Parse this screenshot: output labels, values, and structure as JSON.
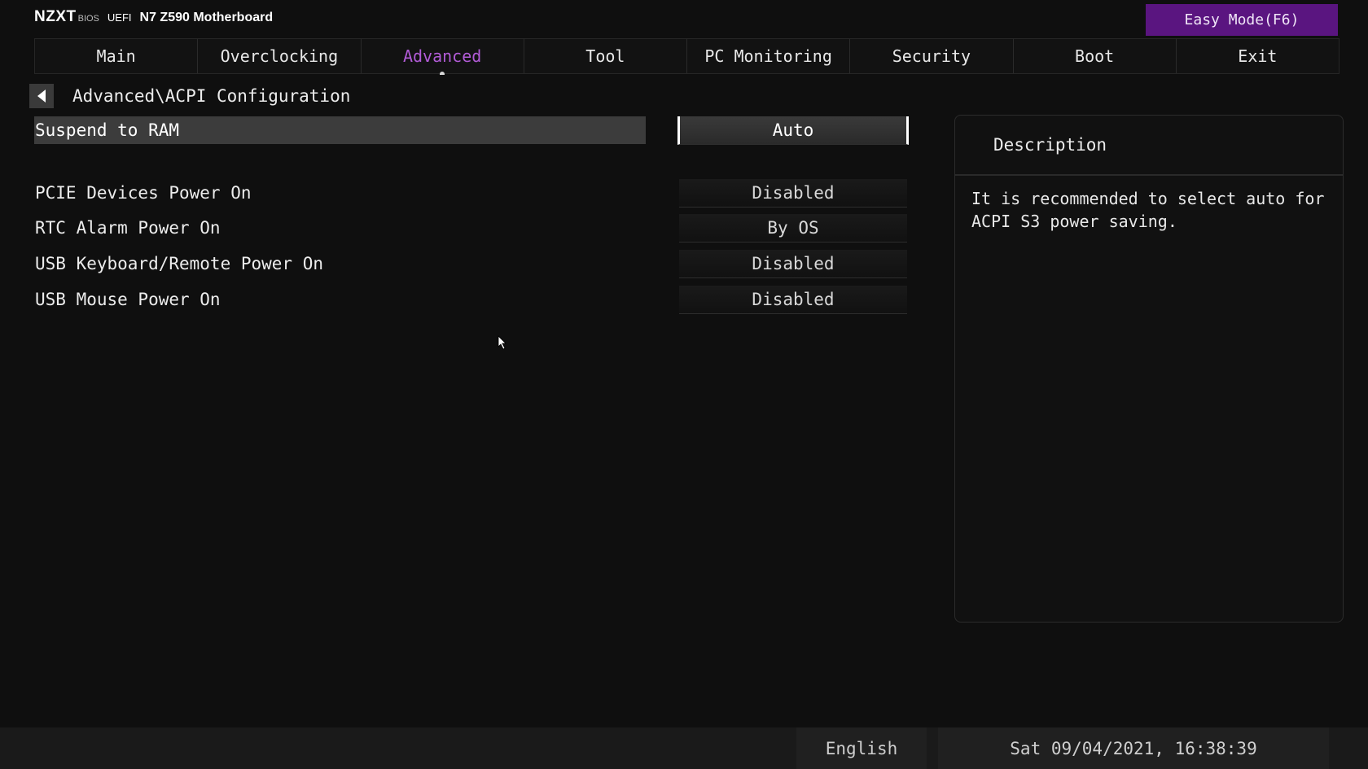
{
  "header": {
    "logo": "NZXT",
    "bios": "BIOS",
    "uefi": "UEFI",
    "model": "N7 Z590 Motherboard",
    "easy_mode_label": "Easy Mode(F6)"
  },
  "tabs": [
    {
      "label": "Main",
      "active": false
    },
    {
      "label": "Overclocking",
      "active": false
    },
    {
      "label": "Advanced",
      "active": true
    },
    {
      "label": "Tool",
      "active": false
    },
    {
      "label": "PC Monitoring",
      "active": false
    },
    {
      "label": "Security",
      "active": false
    },
    {
      "label": "Boot",
      "active": false
    },
    {
      "label": "Exit",
      "active": false
    }
  ],
  "breadcrumb": "Advanced\\ACPI Configuration",
  "settings": [
    {
      "label": "Suspend to RAM",
      "value": "Auto",
      "selected": true
    },
    {
      "label": "PCIE Devices Power On",
      "value": "Disabled",
      "selected": false
    },
    {
      "label": "RTC Alarm Power On",
      "value": "By OS",
      "selected": false
    },
    {
      "label": "USB Keyboard/Remote Power On",
      "value": "Disabled",
      "selected": false
    },
    {
      "label": "USB Mouse Power On",
      "value": "Disabled",
      "selected": false
    }
  ],
  "description": {
    "title": "Description",
    "text": "It is recommended to select auto for ACPI S3 power saving."
  },
  "footer": {
    "language": "English",
    "datetime": "Sat 09/04/2021, 16:38:39"
  },
  "colors": {
    "accent": "#b15bd6",
    "easy_mode_bg": "#5a1580",
    "background": "#0f0f0f"
  },
  "icons": {
    "back": "chevron-left-icon",
    "cursor": "mouse-pointer-icon"
  }
}
